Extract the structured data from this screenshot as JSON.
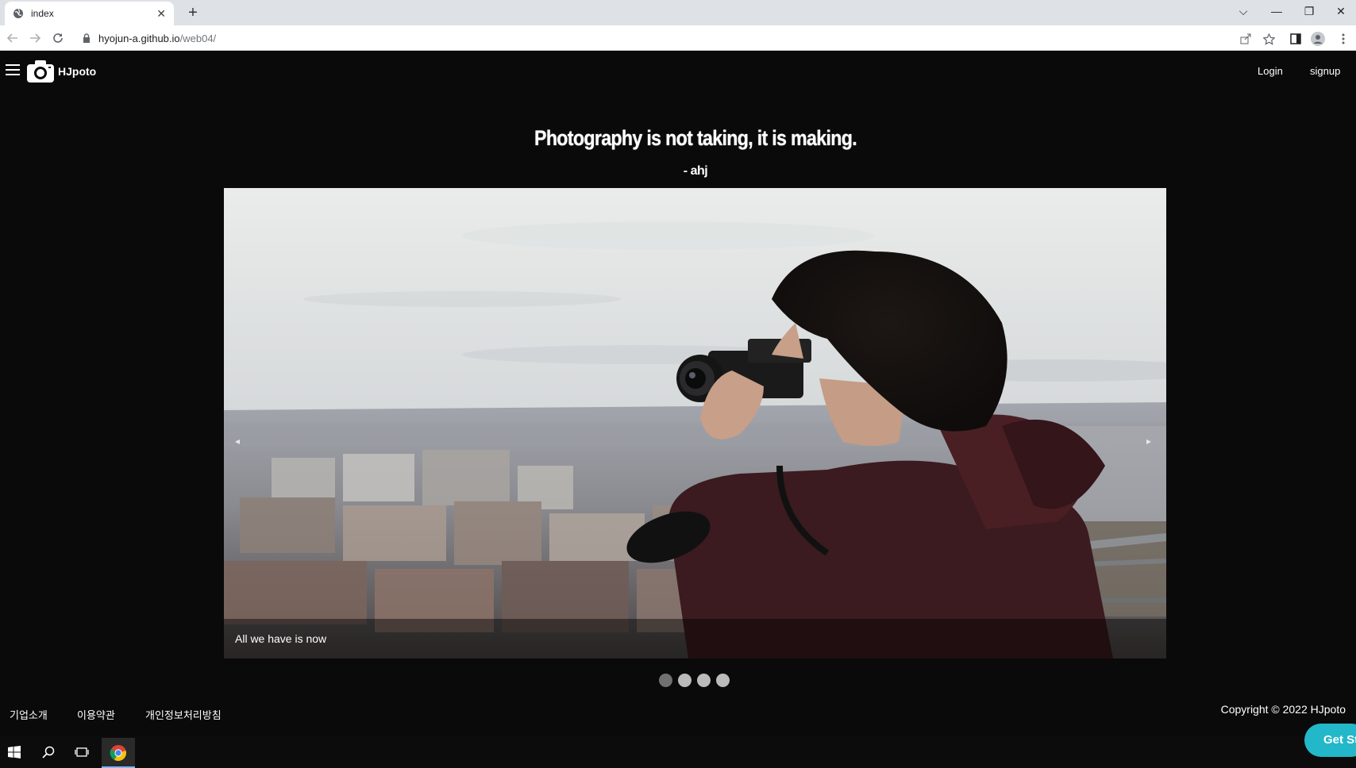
{
  "browser": {
    "tab_title": "index",
    "tab_close": "✕",
    "new_tab": "+",
    "url_host": "hyojun-a.github.io",
    "url_path": "/web04/",
    "window_controls": [
      "⌵",
      "—",
      "❐",
      "✕"
    ]
  },
  "nav": {
    "brand": "HJpoto",
    "login": "Login",
    "signup": "signup"
  },
  "hero": {
    "quote": "Photography is not taking, it is making.",
    "author": "- ahj"
  },
  "slider": {
    "caption": "All we have is now",
    "prev": "◂",
    "next": "▸",
    "dots": [
      {
        "active": true
      },
      {
        "active": false
      },
      {
        "active": false
      },
      {
        "active": false
      }
    ]
  },
  "footer": {
    "links": [
      "기업소개",
      "이용약관",
      "개인정보처리방침"
    ],
    "copyright": "Copyright © 2022 HJpoto"
  },
  "taskbar": {
    "widget_label": "Get St"
  },
  "colors": {
    "page_bg": "#0a0a0a",
    "widget": "#23b8c9",
    "dot_active": "#717171",
    "dot_inactive": "#bbbbbb"
  }
}
